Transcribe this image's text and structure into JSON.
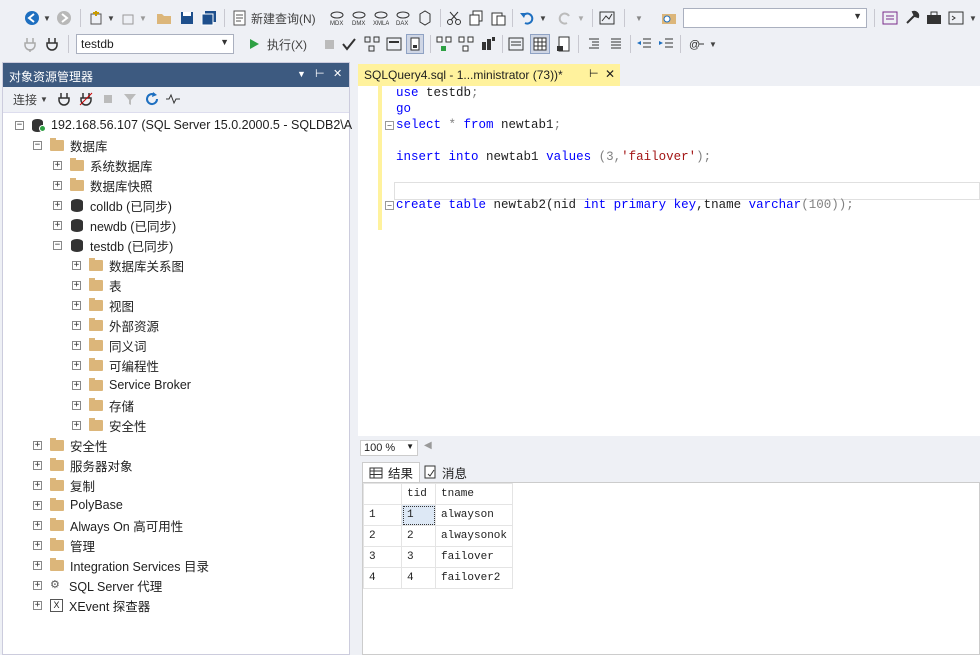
{
  "toolbar1": {
    "new_query_label": "新建查询(N)",
    "search_placeholder": ""
  },
  "toolbar2": {
    "database_value": "testdb",
    "execute_label": "执行(X)"
  },
  "object_explorer": {
    "title": "对象资源管理器",
    "connect_label": "连接",
    "server": "192.168.56.107 (SQL Server 15.0.2000.5 - SQLDB2\\A",
    "databases_label": "数据库",
    "system_databases": "系统数据库",
    "snapshots": "数据库快照",
    "db_colldb": "colldb (已同步)",
    "db_newdb": "newdb (已同步)",
    "db_testdb": "testdb (已同步)",
    "testdb_children": [
      "数据库关系图",
      "表",
      "视图",
      "外部资源",
      "同义词",
      "可编程性",
      "Service Broker",
      "存储",
      "安全性"
    ],
    "top_items": [
      "安全性",
      "服务器对象",
      "复制",
      "PolyBase",
      "Always On 高可用性",
      "管理",
      "Integration Services 目录"
    ],
    "agent": "SQL Server 代理",
    "xevent": "XEvent 探查器"
  },
  "editor_tab": {
    "title": "SQLQuery4.sql - 1...ministrator (73))*",
    "pin": "⊢",
    "close": "✕"
  },
  "code": {
    "l1_kw": "use",
    "l1_rest": " testdb",
    "l2_kw": "go",
    "l3_kw": "select",
    "l3_a": " * ",
    "l3_kw2": "from",
    "l3_b": " newtab1",
    "l4_kw": "insert",
    "l4_a": " ",
    "l4_kw2": "into",
    "l4_b": " newtab1 ",
    "l4_kw3": "values",
    "l4_c": " (3,",
    "l4_str": "'failover'",
    "l4_d": ")",
    "l5_kw": "create",
    "l5_a": " ",
    "l5_kw2": "table",
    "l5_b": " newtab2(nid ",
    "l5_kw3": "int",
    "l5_c": " ",
    "l5_kw4": "primary",
    "l5_d": " ",
    "l5_kw5": "key",
    "l5_e": ",tname ",
    "l5_kw6": "varchar",
    "l5_f": "(100))"
  },
  "zoom": "100 %",
  "results": {
    "tab_results": "结果",
    "tab_messages": "消息",
    "columns": [
      "tid",
      "tname"
    ],
    "rows": [
      {
        "rn": "1",
        "tid": "1",
        "tname": "alwayson"
      },
      {
        "rn": "2",
        "tid": "2",
        "tname": "alwaysonok"
      },
      {
        "rn": "3",
        "tid": "3",
        "tname": "failover"
      },
      {
        "rn": "4",
        "tid": "4",
        "tname": "failover2"
      }
    ]
  }
}
